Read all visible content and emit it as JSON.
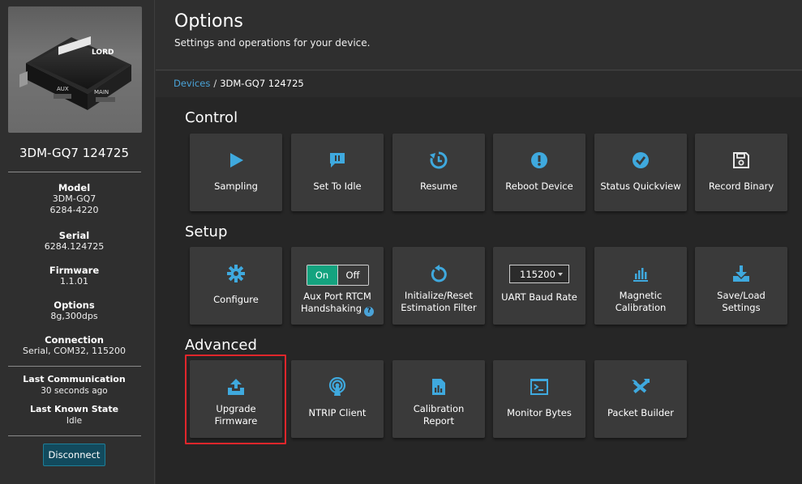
{
  "sidebar": {
    "device_name": "3DM-GQ7 124725",
    "model": {
      "label": "Model",
      "line1": "3DM-GQ7",
      "line2": "6284-4220"
    },
    "serial": {
      "label": "Serial",
      "value": "6284.124725"
    },
    "firmware": {
      "label": "Firmware",
      "value": "1.1.01"
    },
    "options": {
      "label": "Options",
      "value": "8g,300dps"
    },
    "connection": {
      "label": "Connection",
      "value": "Serial, COM32, 115200"
    },
    "last_communication": {
      "label": "Last Communication",
      "value": "30 seconds ago"
    },
    "last_known_state": {
      "label": "Last Known State",
      "value": "Idle"
    },
    "disconnect_label": "Disconnect",
    "device_brand": "LORD",
    "port_aux": "AUX",
    "port_main": "MAIN"
  },
  "header": {
    "title": "Options",
    "subtitle": "Settings and operations for your device."
  },
  "breadcrumb": {
    "root": "Devices",
    "separator": "/",
    "current": "3DM-GQ7 124725"
  },
  "sections": {
    "control": {
      "title": "Control",
      "tiles": [
        {
          "label": "Sampling",
          "icon": "play-icon"
        },
        {
          "label": "Set To Idle",
          "icon": "pause-message-icon"
        },
        {
          "label": "Resume",
          "icon": "history-icon"
        },
        {
          "label": "Reboot Device",
          "icon": "exclamation-circle-icon"
        },
        {
          "label": "Status Quickview",
          "icon": "check-circle-icon"
        },
        {
          "label": "Record Binary",
          "icon": "save-icon"
        }
      ]
    },
    "setup": {
      "title": "Setup",
      "tiles": [
        {
          "label": "Configure",
          "icon": "gear-icon"
        },
        {
          "label_line1": "Aux Port RTCM",
          "label_line2": "Handshaking",
          "toggle_on": "On",
          "toggle_off": "Off",
          "help": "?"
        },
        {
          "label_line1": "Initialize/Reset",
          "label_line2": "Estimation Filter",
          "icon": "reset-icon"
        },
        {
          "label": "UART Baud Rate",
          "select_value": "115200"
        },
        {
          "label_line1": "Magnetic",
          "label_line2": "Calibration",
          "icon": "bar-chart-icon"
        },
        {
          "label_line1": "Save/Load",
          "label_line2": "Settings",
          "icon": "download-icon"
        }
      ]
    },
    "advanced": {
      "title": "Advanced",
      "tiles": [
        {
          "label_line1": "Upgrade",
          "label_line2": "Firmware",
          "icon": "upload-tray-icon"
        },
        {
          "label": "NTRIP Client",
          "icon": "broadcast-icon"
        },
        {
          "label_line1": "Calibration",
          "label_line2": "Report",
          "icon": "report-icon"
        },
        {
          "label": "Monitor Bytes",
          "icon": "terminal-icon"
        },
        {
          "label": "Packet Builder",
          "icon": "tools-icon"
        }
      ]
    }
  },
  "colors": {
    "accent": "#4aa3d8",
    "toggle_on": "#14a37f",
    "highlight": "#e0262b",
    "tile_bg": "#3a3a3a"
  }
}
